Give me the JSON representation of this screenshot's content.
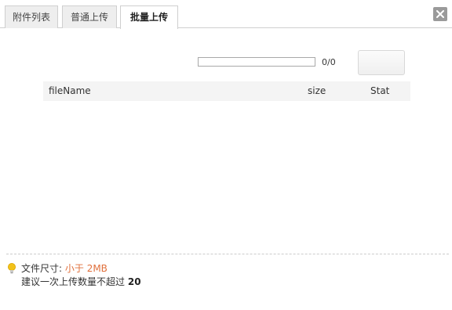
{
  "tabs": [
    {
      "label": "附件列表",
      "active": false
    },
    {
      "label": "普通上传",
      "active": false
    },
    {
      "label": "批量上传",
      "active": true
    }
  ],
  "icons": {
    "close": "close-icon",
    "tip": "lightbulb-icon"
  },
  "progress": {
    "count_text": "0/0",
    "fraction": 0
  },
  "file_table": {
    "columns": [
      "fileName",
      "size",
      "Stat"
    ],
    "rows": []
  },
  "tips": {
    "size_label": "文件尺寸:",
    "size_value": "小于 2MB",
    "batch_text": "建议一次上传数量不超过",
    "batch_value": "20"
  },
  "colors": {
    "highlight": "#e0703c",
    "tab_inactive_bg": "#eeeeee",
    "border": "#cfcfcf"
  }
}
